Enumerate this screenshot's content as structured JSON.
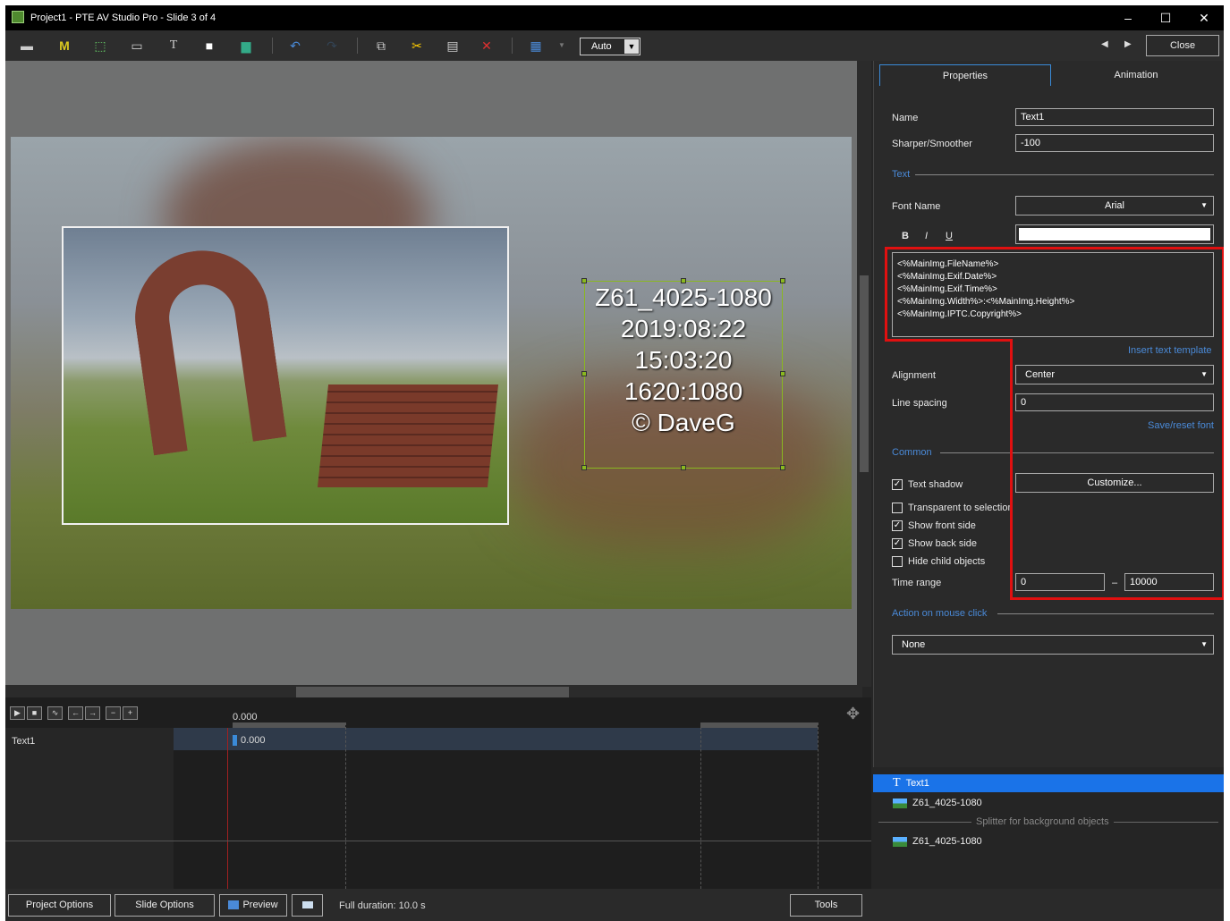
{
  "window": {
    "title": "Project1 - PTE AV Studio Pro - Slide 3 of 4",
    "minimize": "–",
    "maximize": "☐",
    "close": "✕"
  },
  "toolbar": {
    "m_label": "M",
    "t_label": "T",
    "auto_select": "Auto",
    "close_label": "Close",
    "prev": "◀",
    "next": "▶"
  },
  "canvas": {
    "text_lines": [
      "Z61_4025-1080",
      "2019:08:22",
      "15:03:20",
      "1620:1080",
      "© DaveG"
    ]
  },
  "timeline": {
    "time_header": "0.000",
    "row_time": "0.000",
    "object_name": "Text1"
  },
  "status": {
    "project_options": "Project Options",
    "slide_options": "Slide Options",
    "preview": "Preview",
    "full_duration": "Full duration: 10.0 s",
    "tools": "Tools"
  },
  "panel": {
    "tabs": [
      "Properties",
      "Animation"
    ],
    "name_label": "Name",
    "name_value": "Text1",
    "sharper_label": "Sharper/Smoother",
    "sharper_value": "-100",
    "text_section": "Text",
    "font_name_label": "Font Name",
    "font_name_value": "Arial",
    "bold": "B",
    "italic": "I",
    "underline": "U",
    "template_lines": [
      "<%MainImg.FileName%>",
      "<%MainImg.Exif.Date%>",
      "<%MainImg.Exif.Time%>",
      "<%MainImg.Width%>:<%MainImg.Height%>",
      "<%MainImg.IPTC.Copyright%>"
    ],
    "insert_template": "Insert text template",
    "alignment_label": "Alignment",
    "alignment_value": "Center",
    "line_spacing_label": "Line spacing",
    "line_spacing_value": "0",
    "save_reset_font": "Save/reset font",
    "common_section": "Common",
    "text_shadow": "Text shadow",
    "text_shadow_checked": true,
    "customize": "Customize...",
    "transparent": "Transparent to selection",
    "transparent_checked": false,
    "show_front": "Show front side",
    "show_front_checked": true,
    "show_back": "Show back side",
    "show_back_checked": true,
    "hide_child": "Hide child objects",
    "hide_child_checked": false,
    "time_range_label": "Time range",
    "time_from": "0",
    "time_dash": "–",
    "time_to": "10000",
    "action_section": "Action on mouse click",
    "action_value": "None"
  },
  "objects": {
    "items": [
      "Text1",
      "Z61_4025-1080",
      "Z61_4025-1080"
    ],
    "splitter": "Splitter for background objects"
  }
}
